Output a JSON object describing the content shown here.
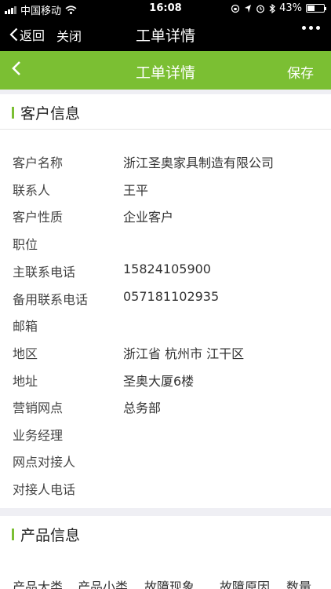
{
  "status_bar": {
    "carrier": "中国移动",
    "time": "16:08",
    "battery": "43%",
    "battery_level": 0.43
  },
  "wechat_bar": {
    "back_label": "返回",
    "close_label": "关闭",
    "title": "工单详情"
  },
  "app_bar": {
    "title": "工单详情",
    "save_label": "保存",
    "accent_color": "#7bbf33"
  },
  "customer": {
    "section_title": "客户信息",
    "rows": [
      {
        "label": "客户名称",
        "value": "浙江圣奥家具制造有限公司"
      },
      {
        "label": "联系人",
        "value": "王平"
      },
      {
        "label": "客户性质",
        "value": "企业客户"
      },
      {
        "label": "职位",
        "value": ""
      },
      {
        "label": "主联系电话",
        "value": "15824105900"
      },
      {
        "label": "备用联系电话",
        "value": "057181102935"
      },
      {
        "label": "邮箱",
        "value": ""
      },
      {
        "label": "地区",
        "value": "浙江省 杭州市 江干区"
      },
      {
        "label": "地址",
        "value": "圣奥大厦6楼"
      },
      {
        "label": "营销网点",
        "value": "总务部"
      },
      {
        "label": "业务经理",
        "value": ""
      },
      {
        "label": "网点对接人",
        "value": ""
      },
      {
        "label": "对接人电话",
        "value": ""
      }
    ]
  },
  "product": {
    "section_title": "产品信息",
    "columns": [
      "产品大类",
      "产品小类",
      "故障现象",
      "故障原因",
      "数量"
    ]
  }
}
